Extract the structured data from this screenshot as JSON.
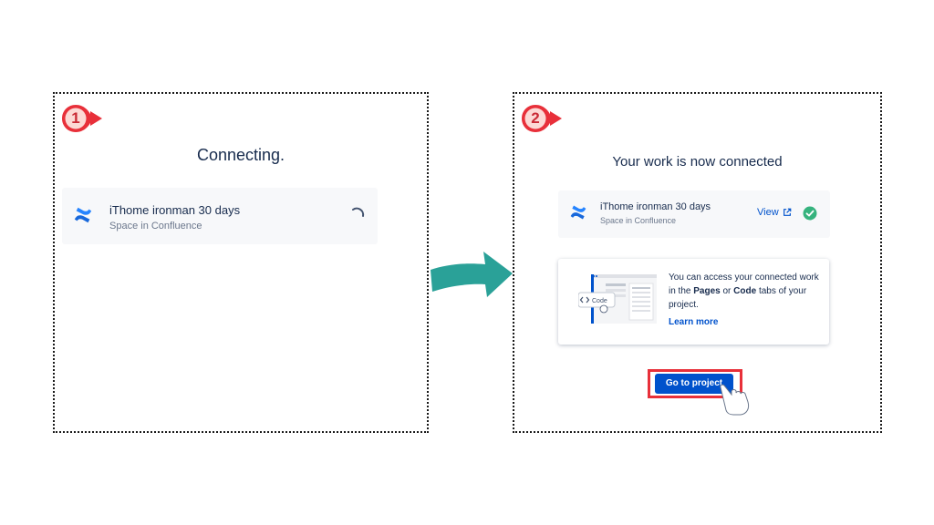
{
  "steps": {
    "step1": {
      "number": "1",
      "title": "Connecting.",
      "space": {
        "name": "iThome ironman 30 days",
        "type": "Space in Confluence"
      },
      "loading_icon": "spinner-icon"
    },
    "step2": {
      "number": "2",
      "title": "Your work is now connected",
      "space": {
        "name": "iThome ironman 30 days",
        "type": "Space in Confluence"
      },
      "view_label": "View",
      "info": {
        "text_before": "You can access your connected work in the ",
        "pages": "Pages",
        "or": " or ",
        "code": "Code",
        "text_after": " tabs of your project.",
        "illustration_label": "Code",
        "learn_more": "Learn more"
      },
      "go_button": "Go to project"
    }
  },
  "colors": {
    "marker": "#e8303a",
    "marker_text": "#c92a35",
    "arrow": "#2aa198",
    "link": "#0052cc",
    "success": "#36b37e",
    "confluence": "#1868db",
    "highlight": "#e8303a"
  },
  "icons": [
    "confluence-logo-icon",
    "spinner-icon",
    "external-link-icon",
    "check-circle-icon",
    "code-icon",
    "pointer-hand-icon",
    "arrow-right-icon"
  ]
}
